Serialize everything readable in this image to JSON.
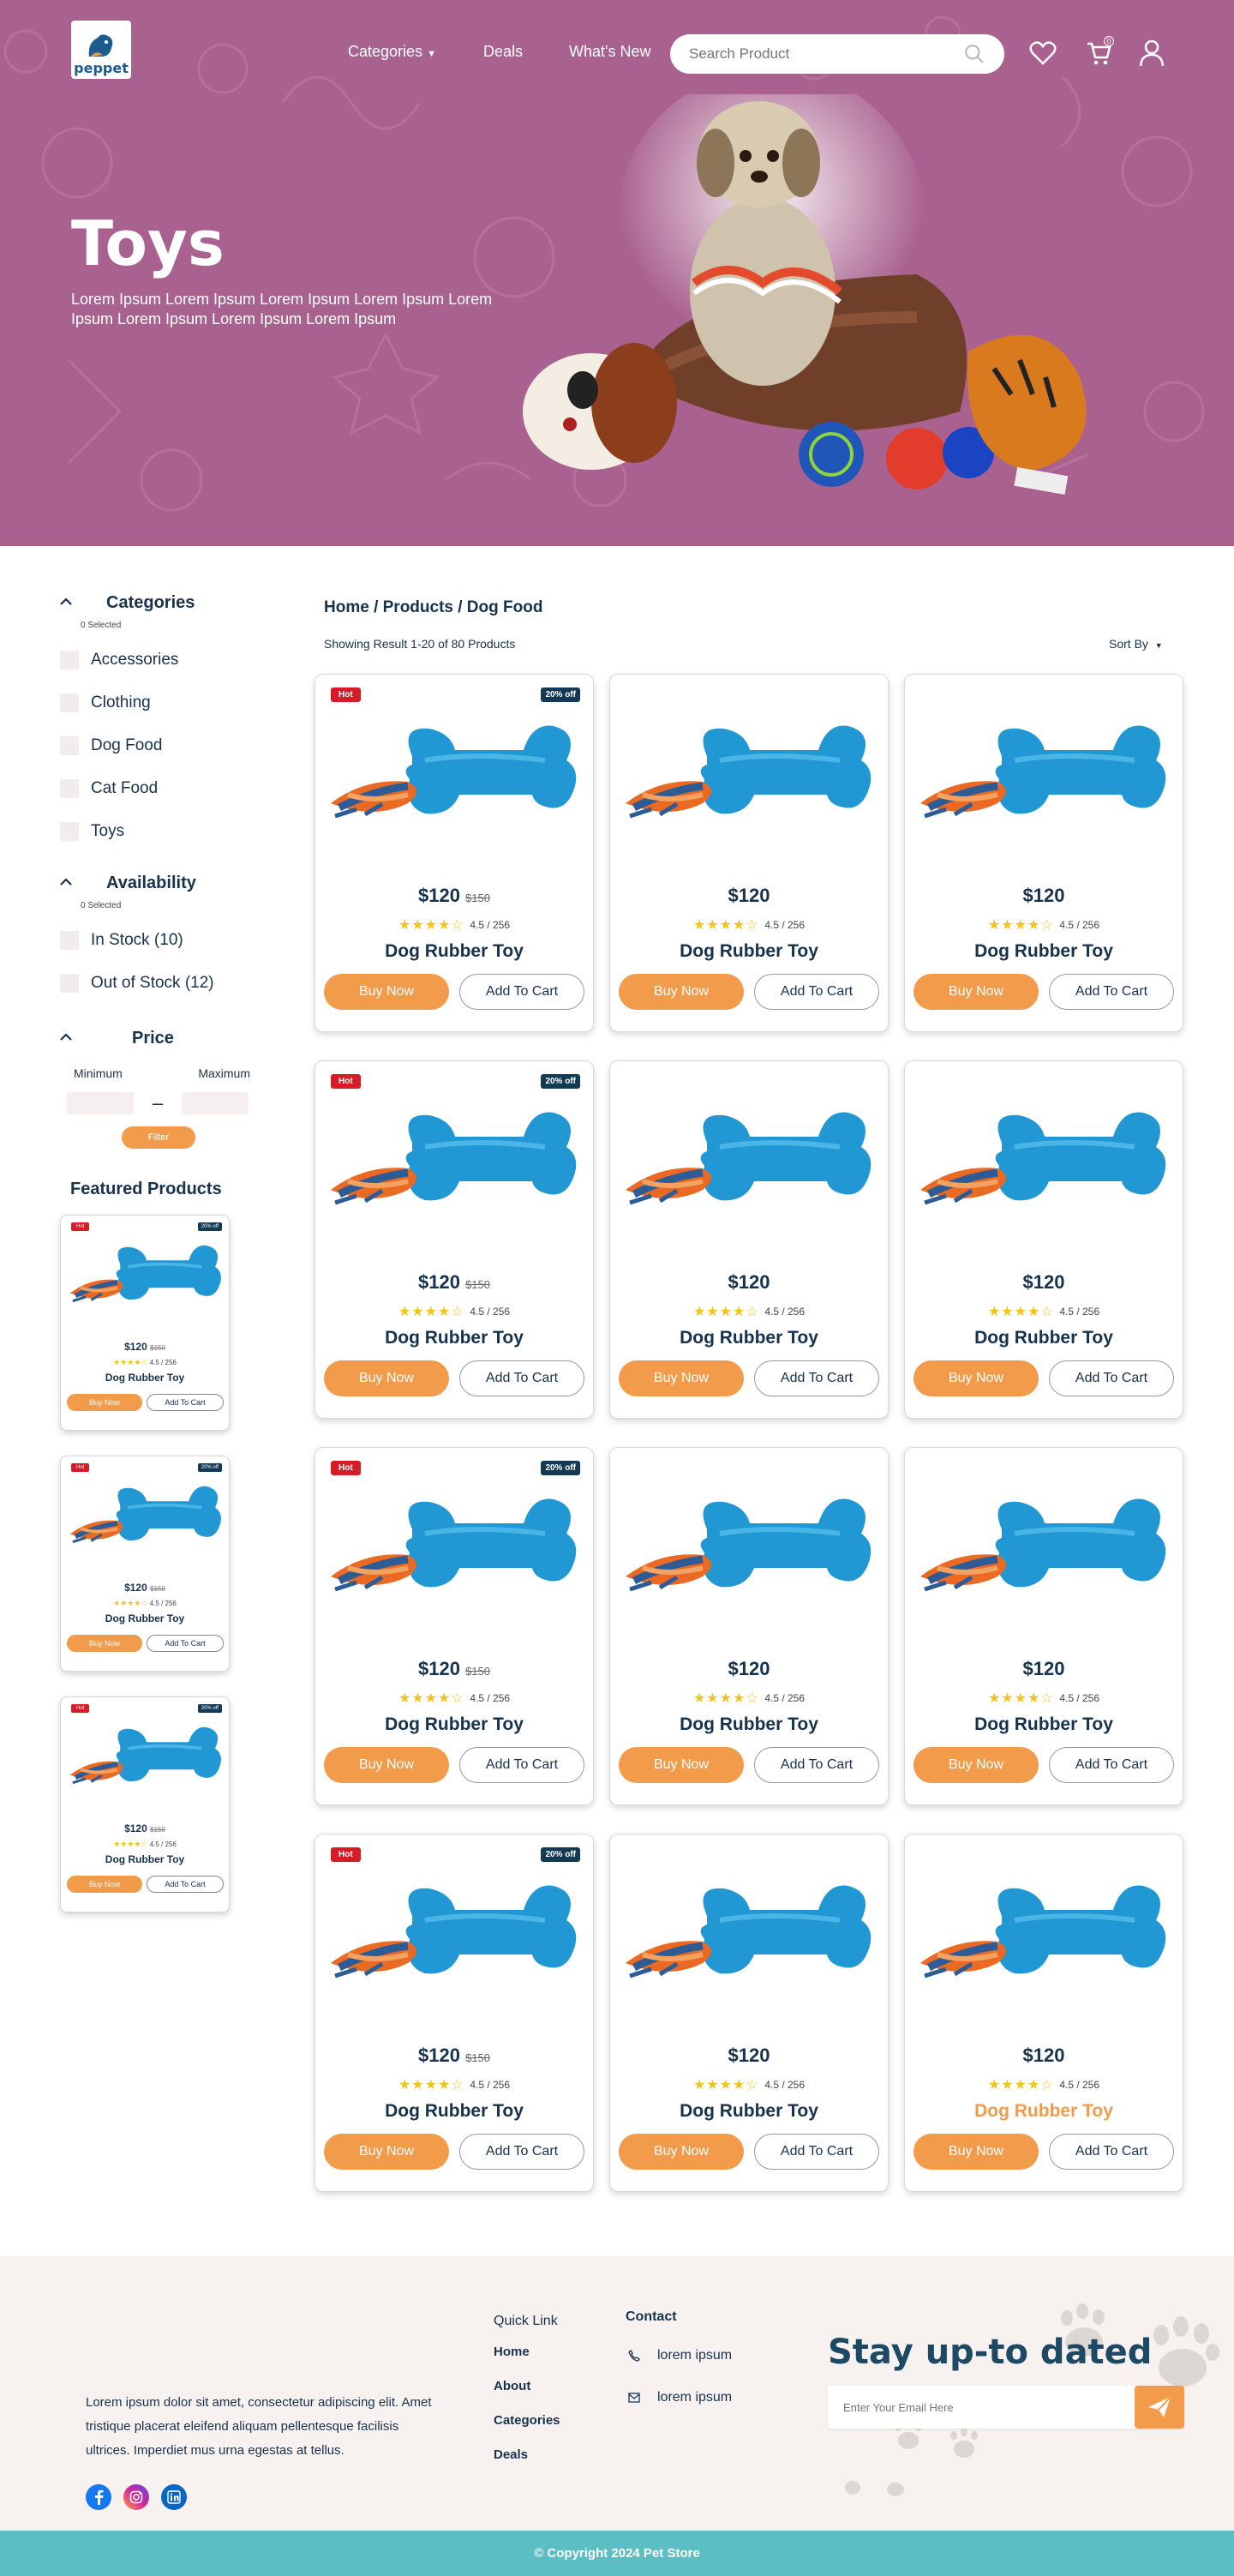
{
  "header": {
    "logo_text": "peppet",
    "nav": [
      "Categories",
      "Deals",
      "What's New"
    ],
    "search_placeholder": "Search Product",
    "cart_count": "0"
  },
  "hero": {
    "title": "Toys",
    "subtitle": "Lorem Ipsum Lorem Ipsum Lorem Ipsum Lorem Ipsum Lorem Ipsum Lorem Ipsum Lorem Ipsum Lorem Ipsum"
  },
  "sidebar": {
    "categories": {
      "title": "Categories",
      "selected": "0 Selected",
      "items": [
        "Accessories",
        "Clothing",
        "Dog Food",
        "Cat Food",
        "Toys"
      ]
    },
    "availability": {
      "title": "Availability",
      "selected": "0 Selected",
      "items": [
        "In Stock  (10)",
        "Out of Stock  (12)"
      ]
    },
    "price": {
      "title": "Price",
      "min_label": "Minimum",
      "max_label": "Maximum",
      "dash": "–",
      "filter_label": "Filter"
    },
    "featured_title": "Featured Products"
  },
  "main": {
    "breadcrumb": "Home / Products / Dog Food",
    "result_text": "Showing Result 1-20 of 80 Products",
    "sort_label": "Sort By"
  },
  "product": {
    "hot_label": "Hot",
    "off_label": "20% off",
    "price": "$120",
    "old_price": "$150",
    "rating_text": "4.5 / 256",
    "rating_value": 4.5,
    "rating_max": 5,
    "name": "Dog Rubber Toy",
    "buy_label": "Buy Now",
    "cart_label": "Add To Cart"
  },
  "footer": {
    "about": "Lorem ipsum dolor sit amet, consectetur adipiscing elit. Amet tristique placerat eleifend aliquam pellentesque facilisis ultrices. Imperdiet mus urna egestas at tellus.",
    "quick_link_title": "Quick Link",
    "quick_links": [
      "Home",
      "About",
      "Categories",
      "Deals"
    ],
    "contact_title": "Contact",
    "contacts": [
      "lorem ipsum",
      "lorem ipsum"
    ],
    "newsletter_title": "Stay up-to dated",
    "email_placeholder": "Enter Your Email Here",
    "copyright": "© Copyright 2024 Pet Store"
  },
  "colors": {
    "hero_bg": "#a9628f",
    "accent": "#f29b4b",
    "navy": "#17324d",
    "hot": "#d61c26",
    "copyright_bg": "#5bbec4"
  }
}
